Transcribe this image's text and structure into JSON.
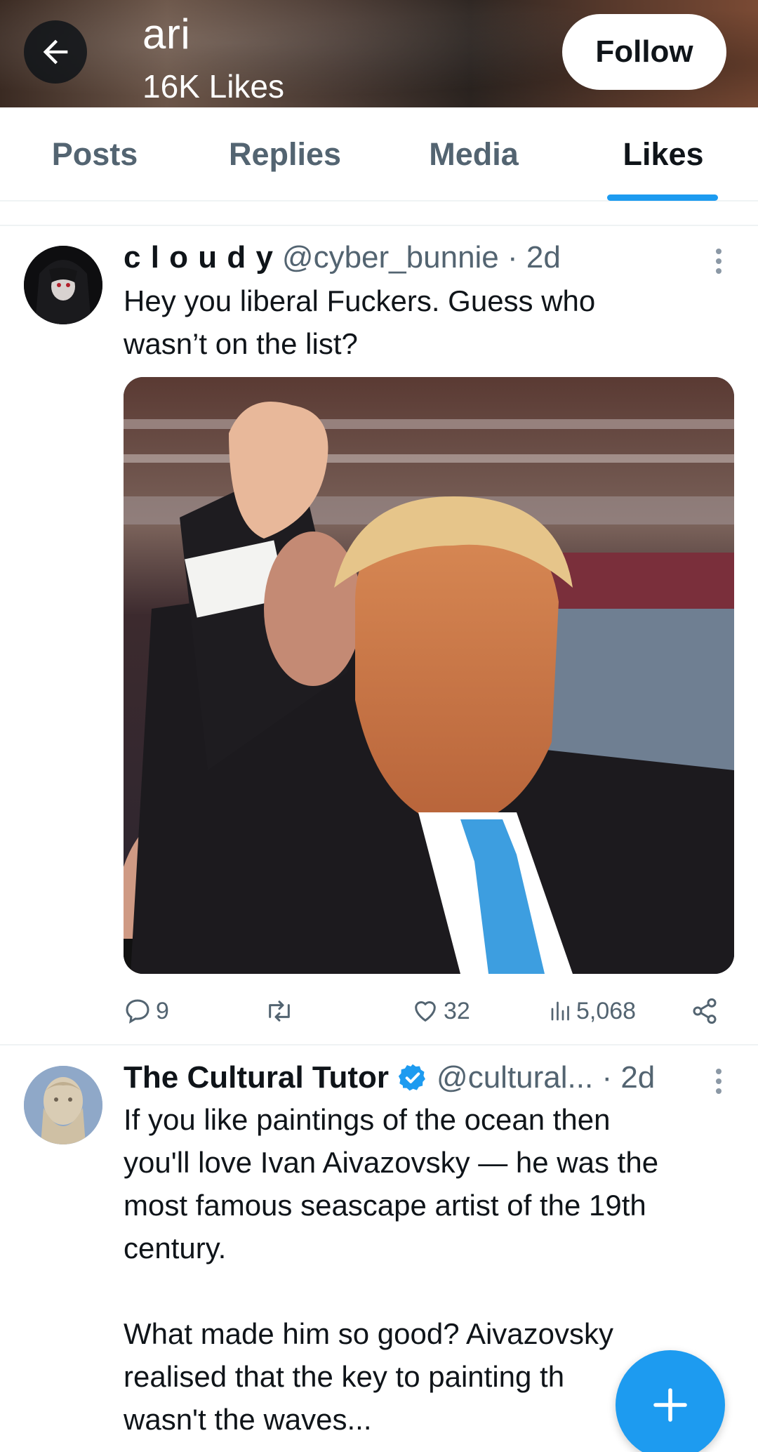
{
  "header": {
    "title": "ari",
    "subtitle": "16K Likes",
    "follow_label": "Follow"
  },
  "tabs": [
    {
      "label": "Posts",
      "active": false
    },
    {
      "label": "Replies",
      "active": false
    },
    {
      "label": "Media",
      "active": false
    },
    {
      "label": "Likes",
      "active": true
    }
  ],
  "tweets": [
    {
      "name": "c l o u d y",
      "handle": "@cyber_bunnie · 2d",
      "text": "Hey you liberal Fuckers.  Guess who\nwasn’t on the list?",
      "replies": "9",
      "reposts": "",
      "likes": "32",
      "views": "5,068"
    },
    {
      "name": "The Cultural Tutor",
      "handle": "@cultural... · 2d",
      "verified": true,
      "text": "If you like paintings of the ocean then\nyou'll love Ivan Aivazovsky — he was the\nmost famous seascape artist of the 19th\ncentury.\n\nWhat made him so good? Aivazovsky\nrealised that the key to painting th\nwasn't the waves..."
    }
  ],
  "colors": {
    "accent": "#1d9bf0",
    "text_primary": "#0f1419",
    "text_secondary": "#536471"
  }
}
